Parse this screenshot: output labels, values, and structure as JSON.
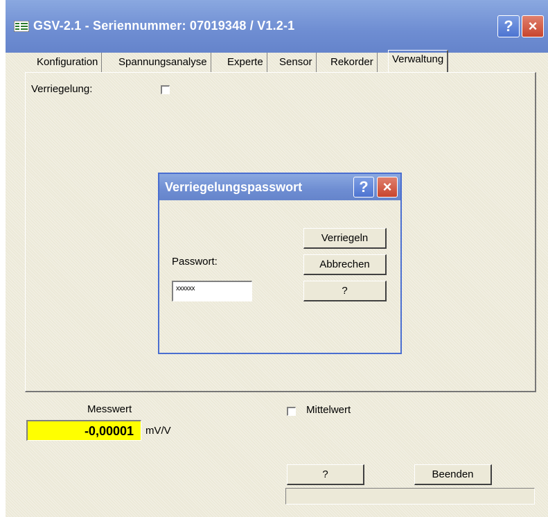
{
  "window": {
    "title": "GSV-2.1 - Seriennummer: 07019348 / V1.2-1",
    "help_label": "?",
    "close_label": "×"
  },
  "tabs": [
    {
      "label": "Konfiguration"
    },
    {
      "label": "Spannungsanalyse"
    },
    {
      "label": "Experte"
    },
    {
      "label": "Sensor"
    },
    {
      "label": "Rekorder"
    },
    {
      "label": "Verwaltung",
      "active": true
    }
  ],
  "panel": {
    "lock_label": "Verriegelung:",
    "lock_checked": false
  },
  "dialog": {
    "title": "Verriegelungspasswort",
    "help_label": "?",
    "close_label": "×",
    "password_label": "Passwort:",
    "password_value": "xxxxxx",
    "buttons": {
      "lock": "Verriegeln",
      "cancel": "Abbrechen",
      "help": "?"
    }
  },
  "measurement": {
    "label": "Messwert",
    "value": "-0,00001",
    "unit": "mV/V",
    "mean_label": "Mittelwert",
    "mean_checked": false
  },
  "footer": {
    "help_label": "?",
    "exit_label": "Beenden"
  },
  "colors": {
    "titlebar": "#6e8dd2",
    "value_highlight": "#ffff00",
    "face": "#ece9d8"
  }
}
